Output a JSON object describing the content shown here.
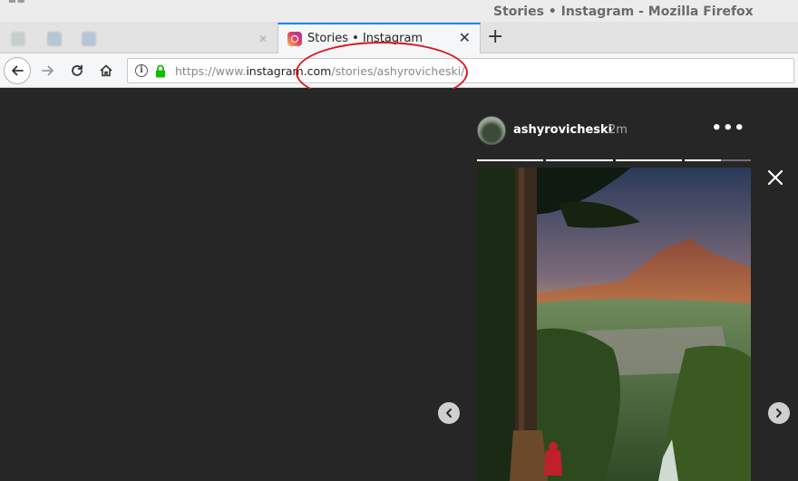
{
  "window": {
    "title": "Stories • Instagram - Mozilla Firefox"
  },
  "tabs": {
    "active_label": "Stories • Instagram",
    "close_glyph": "✕",
    "new_tab_glyph": "+"
  },
  "navbar": {
    "url_scheme": "https://www.",
    "url_host": "instagram.com",
    "url_path": "/stories/ashyrovicheski/"
  },
  "story": {
    "username": "ashyrovicheski",
    "time_ago": "2m",
    "more_glyph": "•••",
    "progress": [
      1,
      1,
      1,
      0.55
    ]
  },
  "icons": {
    "back": "arrow-left-icon",
    "forward": "arrow-right-icon",
    "reload": "reload-icon",
    "home": "home-icon",
    "info": "info-icon",
    "lock": "lock-icon",
    "close": "close-icon",
    "prev": "chevron-left-icon",
    "next": "chevron-right-icon"
  },
  "colors": {
    "stage_bg": "#262626",
    "annotation": "#d71920",
    "lock_green": "#12bc00"
  }
}
